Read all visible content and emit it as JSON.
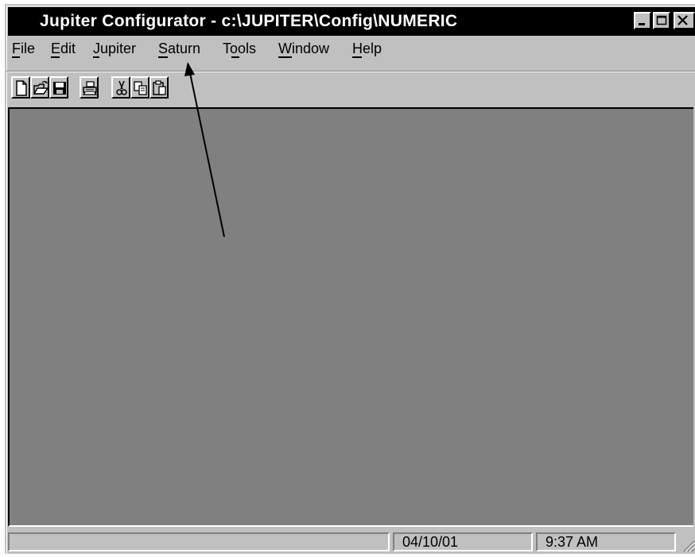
{
  "window": {
    "title": "Jupiter Configurator - c:\\JUPITER\\Config\\NUMERIC",
    "controls": [
      "minimize-icon",
      "maximize-icon",
      "close-icon"
    ]
  },
  "menu": {
    "items": [
      {
        "label": "File",
        "mnemonic": "F"
      },
      {
        "label": "Edit",
        "mnemonic": "E"
      },
      {
        "label": "Jupiter",
        "mnemonic": "J"
      },
      {
        "label": "Saturn",
        "mnemonic": "S"
      },
      {
        "label": "Tools",
        "mnemonic": "o"
      },
      {
        "label": "Window",
        "mnemonic": "W"
      },
      {
        "label": "Help",
        "mnemonic": "H"
      }
    ]
  },
  "toolbar": {
    "buttons": [
      "new-icon",
      "open-icon",
      "save-icon",
      "print-icon",
      "cut-icon",
      "copy-icon",
      "paste-icon"
    ]
  },
  "status": {
    "message": "",
    "date": "04/10/01",
    "time": "9:37 AM"
  },
  "annotation": {
    "type": "arrow",
    "points_to": "Saturn menu"
  },
  "colors": {
    "titlebar_bg": "#000000",
    "titlebar_text": "#ffffff",
    "face": "#c0c0c0",
    "client_bg": "#808080"
  }
}
